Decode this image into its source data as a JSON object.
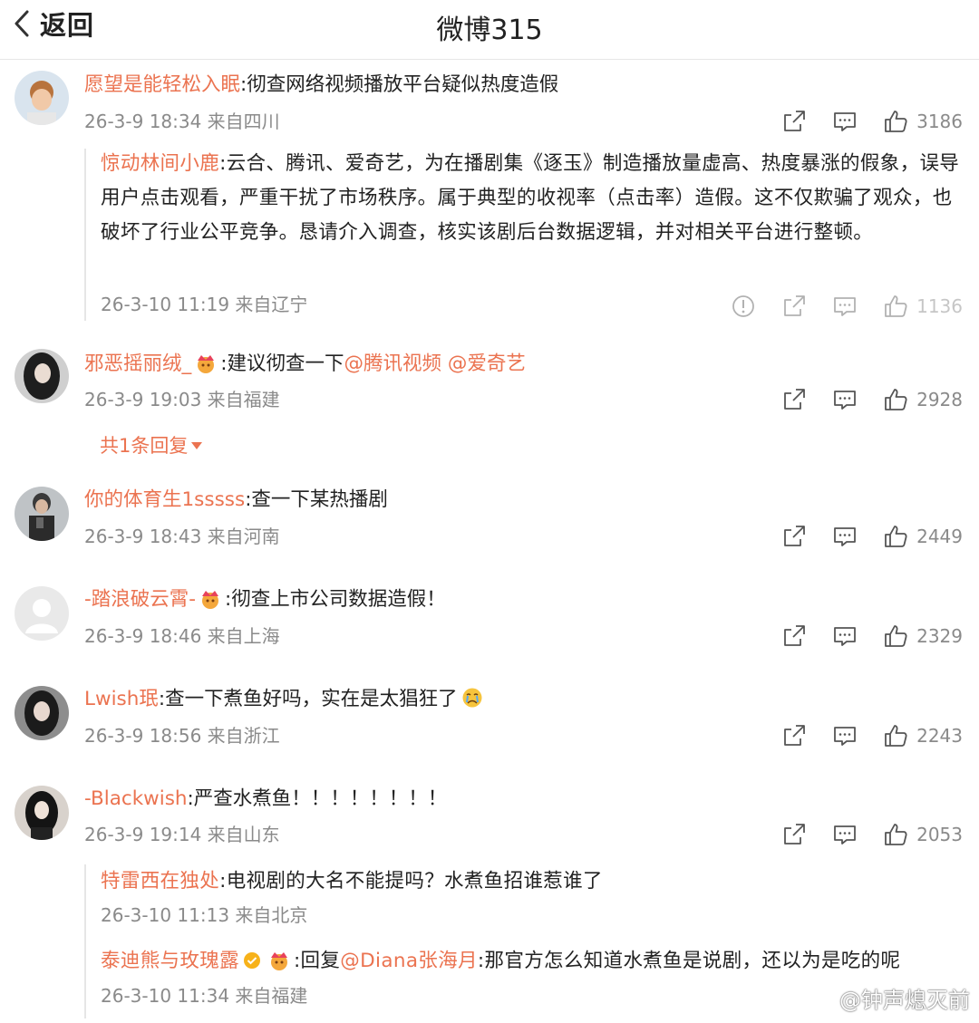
{
  "header": {
    "back_label": "返回",
    "title": "微博315"
  },
  "comments": [
    {
      "user": "愿望是能轻松入眠",
      "text": ":彻查网络视频播放平台疑似热度造假",
      "meta": "26-3-9 18:34 来自四川",
      "likes": "3186",
      "reply": {
        "user": "惊动林间小鹿",
        "text": ":云合、腾讯、爱奇艺，为在播剧集《逐玉》制造播放量虚高、热度暴涨的假象，误导用户点击观看，严重干扰了市场秩序。属于典型的收视率（点击率）造假。这不仅欺骗了观众，也破坏了行业公平竞争。恳请介入调查，核实该剧后台数据逻辑，并对相关平台进行整顿。",
        "meta": "26-3-10 11:19 来自辽宁",
        "likes": "1136"
      }
    },
    {
      "user": "邪恶摇丽绒_",
      "text": ":建议彻查一下",
      "mention1": "@腾讯视频",
      "mention2": "@爱奇艺",
      "meta": "26-3-9 19:03 来自福建",
      "likes": "2928",
      "more_replies": "共1条回复"
    },
    {
      "user": "你的体育生1sssss",
      "text": ":查一下某热播剧",
      "meta": "26-3-9 18:43 来自河南",
      "likes": "2449"
    },
    {
      "user": "-踏浪破云霄-",
      "text": ":彻查上市公司数据造假！",
      "meta": "26-3-9 18:46 来自上海",
      "likes": "2329"
    },
    {
      "user": "Lwish珉",
      "text": ":查一下煮鱼好吗，实在是太猖狂了",
      "meta": "26-3-9 18:56 来自浙江",
      "likes": "2243"
    },
    {
      "user": "-Blackwish",
      "text": ":严查水煮鱼！！！！！！！！",
      "meta": "26-3-9 19:14 来自山东",
      "likes": "2053",
      "replies": [
        {
          "user": "特雷西在独处",
          "text": ":电视剧的大名不能提吗？水煮鱼招谁惹谁了",
          "meta": "26-3-10 11:13 来自北京"
        },
        {
          "user": "泰迪熊与玫瑰露",
          "text_prefix": ":回复",
          "mention": "@Diana张海月",
          "text": ":那官方怎么知道水煮鱼是说剧，还以为是吃的呢",
          "meta": "26-3-10 11:34 来自福建"
        }
      ]
    }
  ],
  "watermark": "@钟声熄灭前",
  "colors": {
    "username": "#eb7350",
    "meta": "#8a8a8a",
    "text": "#222222",
    "divider": "#e6e6e6"
  },
  "icons": [
    "chevron-left-icon",
    "share-icon",
    "comment-icon",
    "like-icon",
    "report-icon",
    "crown-badge-icon",
    "verified-badge-icon",
    "crying-emoji-icon",
    "weibo-logo-icon"
  ]
}
